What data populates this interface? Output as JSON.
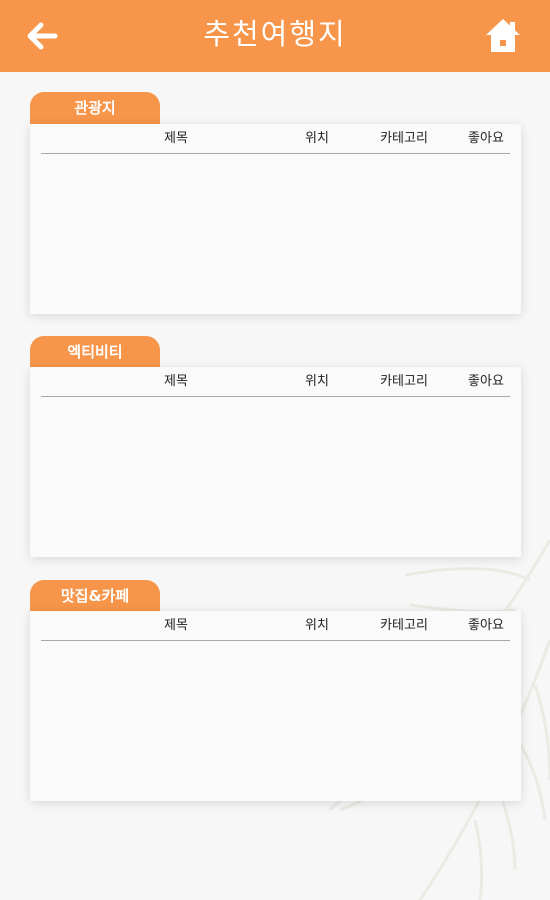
{
  "header": {
    "title": "추천여행지",
    "back_icon": "arrow-left-icon",
    "home_icon": "home-icon",
    "accent_color": "#f7954a"
  },
  "sections": [
    {
      "tab_label": "관광지",
      "columns": [
        "제목",
        "위치",
        "카테고리",
        "좋아요"
      ],
      "rows": []
    },
    {
      "tab_label": "엑티비티",
      "columns": [
        "제목",
        "위치",
        "카테고리",
        "좋아요"
      ],
      "rows": []
    },
    {
      "tab_label": "맛집&카페",
      "columns": [
        "제목",
        "위치",
        "카테고리",
        "좋아요"
      ],
      "rows": []
    }
  ]
}
